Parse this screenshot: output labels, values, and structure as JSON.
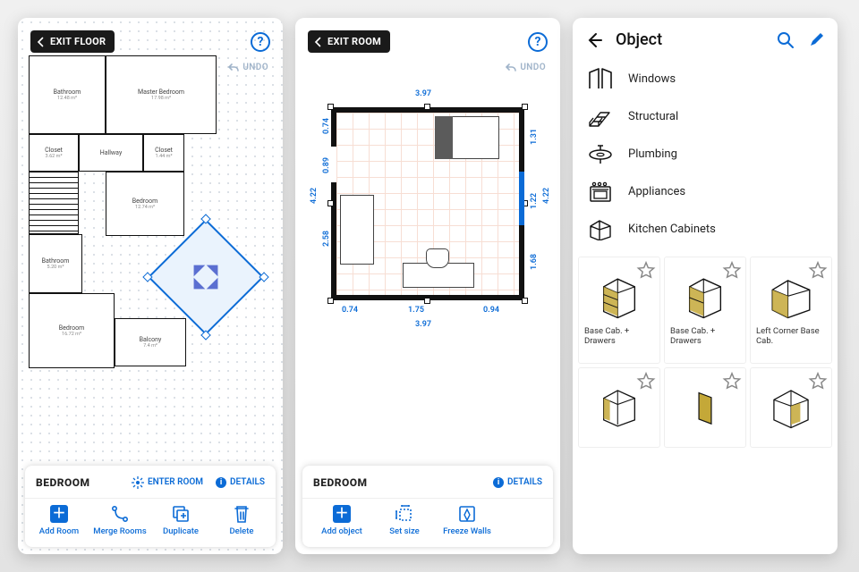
{
  "panel1": {
    "exit_label": "EXIT FLOOR",
    "undo_label": "UNDO",
    "sheet_title": "BEDROOM",
    "enter_room": "ENTER ROOM",
    "details": "DETAILS",
    "actions": {
      "add_room": "Add Room",
      "merge_rooms": "Merge Rooms",
      "duplicate": "Duplicate",
      "delete": "Delete"
    },
    "rooms": {
      "bathroom1": {
        "name": "Bathroom",
        "area": "12.48 m²"
      },
      "master": {
        "name": "Master Bedroom",
        "area": "17.98 m²"
      },
      "closet1": {
        "name": "Closet",
        "area": "3.62 m²"
      },
      "hallway": {
        "name": "Hallway",
        "area": ""
      },
      "closet2": {
        "name": "Closet",
        "area": "1.44 m²"
      },
      "bedroom1": {
        "name": "Bedroom",
        "area": "12.74 m²"
      },
      "bathroom2": {
        "name": "Bathroom",
        "area": "5.20 m²"
      },
      "balcony": {
        "name": "Balcony",
        "area": "7.4 m²"
      },
      "bedroom2": {
        "name": "Bedroom",
        "area": "16.72 m²"
      },
      "drag": {
        "name": "Bedroom"
      }
    }
  },
  "panel2": {
    "exit_label": "EXIT ROOM",
    "undo_label": "UNDO",
    "sheet_title": "BEDROOM",
    "details": "DETAILS",
    "actions": {
      "add_object": "Add object",
      "set_size": "Set size",
      "freeze": "Freeze Walls"
    },
    "dims": {
      "top": "3.97",
      "left_outer": "4.22",
      "right_outer": "4.22",
      "left_a": "0.74",
      "left_b": "0.89",
      "left_c": "2.58",
      "right_a": "1.31",
      "right_b": "1.22",
      "right_c": "1.68",
      "bot_a": "0.74",
      "bot_b": "1.75",
      "bot_c": "0.94",
      "bot_outer": "3.97"
    }
  },
  "panel3": {
    "title": "Object",
    "categories": [
      "Windows",
      "Structural",
      "Plumbing",
      "Appliances",
      "Kitchen Cabinets"
    ],
    "tiles": [
      {
        "label": "Base Cab. + Drawers"
      },
      {
        "label": "Base Cab. + Drawers"
      },
      {
        "label": "Left Corner Base Cab."
      }
    ]
  }
}
